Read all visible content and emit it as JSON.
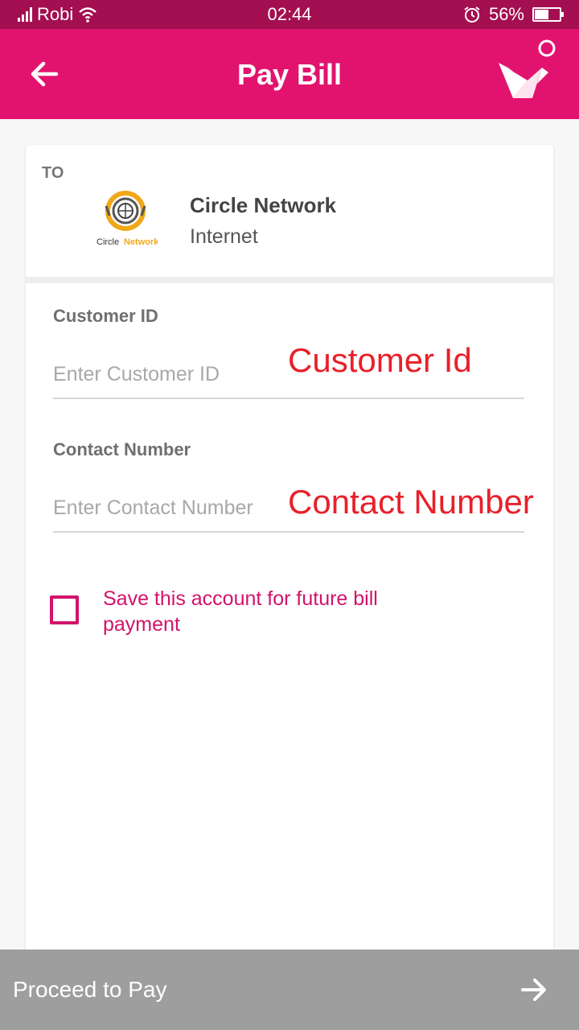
{
  "status_bar": {
    "carrier": "Robi",
    "time": "02:44",
    "battery_percent": "56%",
    "battery_level": 0.56
  },
  "app_bar": {
    "title": "Pay Bill",
    "back_icon": "arrow-left-icon",
    "logo_icon": "origami-bird-icon"
  },
  "recipient": {
    "to_label": "TO",
    "name": "Circle Network",
    "category": "Internet",
    "logo_text_part1": "Circle",
    "logo_text_part2": "Network"
  },
  "form": {
    "customer_id_label": "Customer ID",
    "customer_id_placeholder": "Enter Customer ID",
    "customer_id_value": "",
    "customer_id_annotation": "Customer Id",
    "contact_label": "Contact Number",
    "contact_placeholder": "Enter Contact Number",
    "contact_value": "",
    "contact_annotation": "Contact Number",
    "save_label": "Save this account for future bill payment",
    "save_checked": false
  },
  "footer": {
    "proceed_label": "Proceed to Pay",
    "arrow_icon": "arrow-right-icon"
  },
  "colors": {
    "brand": "#e2136e",
    "status_bar": "#a30f50",
    "annotation": "#e8202a",
    "footer": "#9e9e9e"
  }
}
